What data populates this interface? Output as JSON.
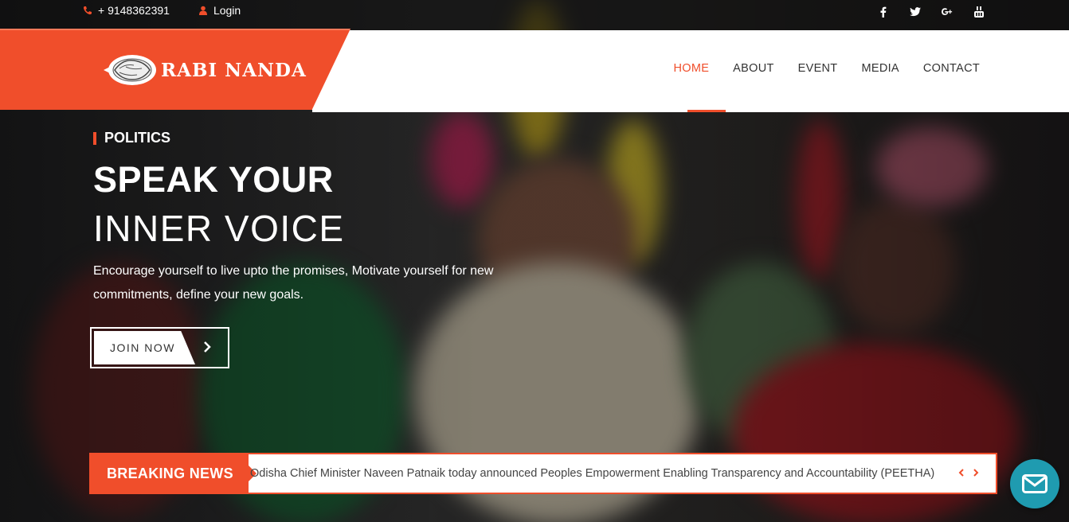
{
  "topbar": {
    "phone": "+ 9148362391",
    "login": "Login",
    "social": [
      "facebook-icon",
      "twitter-icon",
      "google-plus-icon",
      "youtube-icon"
    ]
  },
  "brand": {
    "name": "RABI NANDA"
  },
  "nav": {
    "items": [
      "HOME",
      "ABOUT",
      "EVENT",
      "MEDIA",
      "CONTACT"
    ],
    "active": "HOME"
  },
  "hero": {
    "tag": "POLITICS",
    "title_line1": "SPEAK YOUR",
    "title_line2": "INNER VOICE",
    "description": "Encourage yourself to live upto the promises, Motivate yourself for new commitments, define your new goals.",
    "cta": "JOIN NOW"
  },
  "breaking": {
    "label": "BREAKING NEWS",
    "text": "Odisha Chief Minister Naveen Patnaik today announced Peoples Empowerment Enabling Transparency and Accountability (PEETHA)"
  },
  "colors": {
    "accent": "#f04e2b",
    "chat": "#1f9bb0"
  }
}
